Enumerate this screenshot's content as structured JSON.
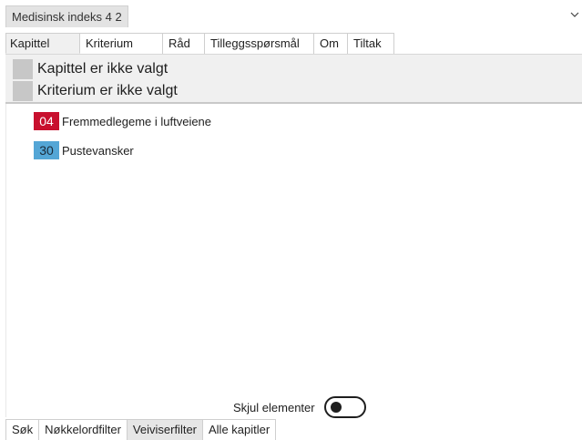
{
  "title_tab": "Medisinsk indeks 4 2",
  "top_tabs": [
    {
      "label": "Kapittel"
    },
    {
      "label": "Kriterium"
    },
    {
      "label": "Råd"
    },
    {
      "label": "Tilleggsspørsmål"
    },
    {
      "label": "Om"
    },
    {
      "label": "Tiltak"
    }
  ],
  "active_top_tab": "Kapittel",
  "selection": {
    "chapter_text": "Kapittel er ikke valgt",
    "criterion_text": "Kriterium er ikke valgt"
  },
  "items": [
    {
      "code": "04",
      "label": "Fremmedlegeme i luftveiene",
      "color": "#c8102e"
    },
    {
      "code": "30",
      "label": "Pustevansker",
      "color": "#54a6d6"
    }
  ],
  "toggle": {
    "label": "Skjul elementer",
    "on": false
  },
  "bottom_tabs": [
    {
      "label": "Søk"
    },
    {
      "label": "Nøkkelordfilter"
    },
    {
      "label": "Veiviserfilter"
    },
    {
      "label": "Alle kapitler"
    }
  ],
  "active_bottom_tab": "Veiviserfilter",
  "icons": {
    "title_chevron": "chevron-down-icon"
  }
}
